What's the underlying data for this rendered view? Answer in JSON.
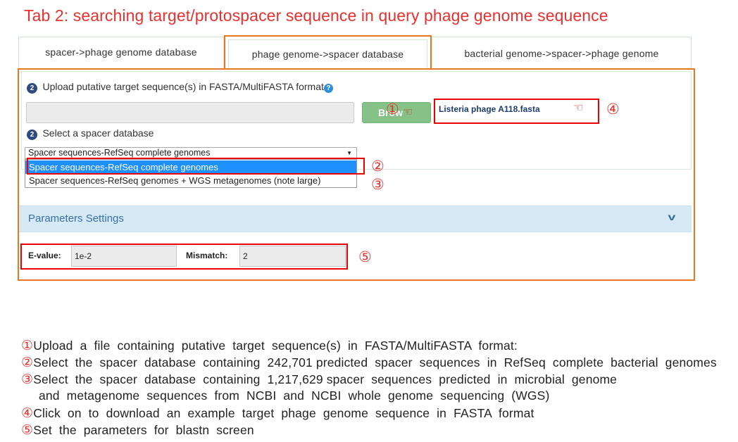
{
  "heading": "Tab 2: searching target/protospacer sequence in query phage genome sequence",
  "tabs": [
    {
      "label": "spacer->phage genome database",
      "active": false
    },
    {
      "label": "phage genome->spacer database",
      "active": true
    },
    {
      "label": "bacterial genome->spacer->phage genome",
      "active": false
    }
  ],
  "upload": {
    "step_badge": "2",
    "label": "Upload putative target sequence(s) in FASTA/MultiFASTA format",
    "help_icon": "question-circle-icon",
    "file_value": "",
    "browse_label": "Browse",
    "browse_label_visible": "Brow",
    "example_link": "Listeria phage A118.fasta"
  },
  "database": {
    "step_badge": "2",
    "label": "Select a spacer database",
    "selected": "Spacer sequences-RefSeq complete genomes",
    "options": [
      "Spacer sequences-RefSeq complete genomes",
      "Spacer sequences-RefSeq genomes + WGS metagenomes (note large)"
    ]
  },
  "parameters": {
    "title": "Parameters Settings",
    "chevron_icon": "chevron-down-icon",
    "evalue_label": "E-value:",
    "evalue_value": "1e-2",
    "mismatch_label": "Mismatch:",
    "mismatch_value": "2"
  },
  "markers": {
    "m1": "①",
    "m2": "②",
    "m3": "③",
    "m4": "④",
    "m5": "⑤"
  },
  "notes": [
    {
      "num": "①",
      "text": "Upload  a  file  containing  putative  target  sequence(s)  in  FASTA/MultiFASTA  format:"
    },
    {
      "num": "②",
      "text": "Select  the  spacer  database  containing  242,701 predicted  spacer  sequences  in  RefSeq  complete  bacterial  genomes"
    },
    {
      "num": "③",
      "text": "Select  the  spacer  database  containing  1,217,629 spacer  sequences  predicted  in  microbial  genome"
    },
    {
      "num": "",
      "text": "and  metagenome  sequences  from  NCBI  and  NCBI  whole  genome  sequencing  (WGS)"
    },
    {
      "num": "④",
      "text": "Click  on  to  download  an  example  target  phage  genome  sequence  in  FASTA  format"
    },
    {
      "num": "⑤",
      "text": "Set  the  parameters  for  blastn  screen"
    }
  ],
  "colors": {
    "heading_red": "#e8312e",
    "tab_highlight_orange": "#e87722",
    "annotation_red": "#e00000",
    "browse_green": "#86c287",
    "param_bar_blue": "#d5eaf5",
    "select_highlight_blue": "#1e90ff"
  }
}
